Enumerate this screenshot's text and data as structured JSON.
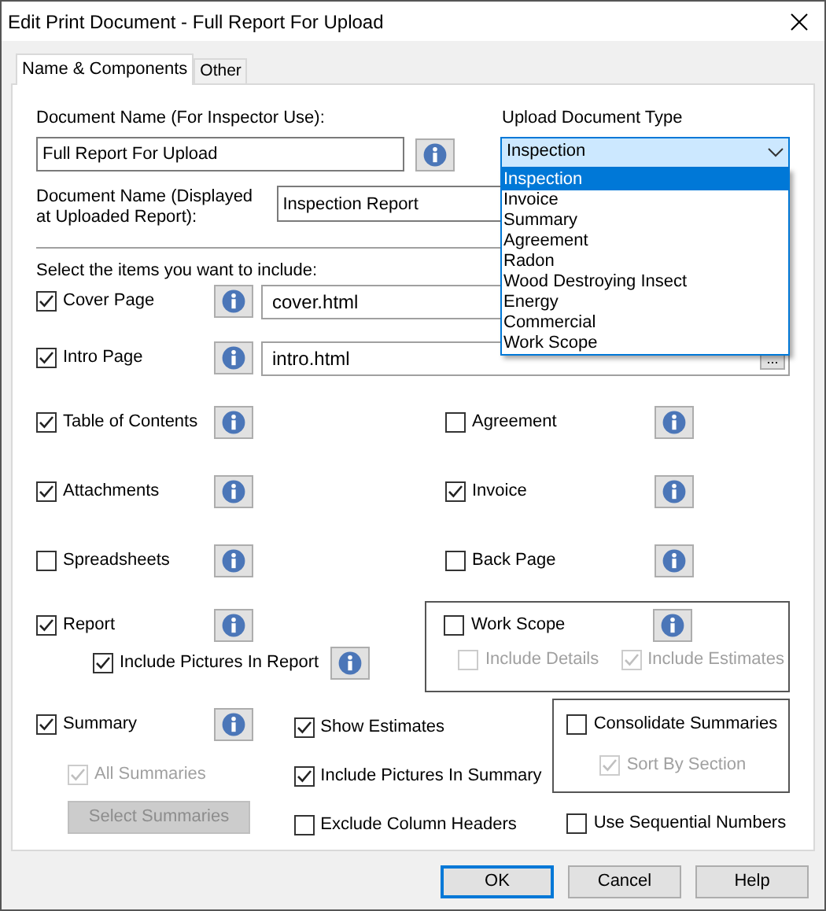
{
  "window": {
    "title": "Edit Print Document - Full Report For Upload"
  },
  "tabs": [
    {
      "label": "Name & Components",
      "selected": true
    },
    {
      "label": "Other",
      "selected": false
    }
  ],
  "document_name": {
    "label": "Document Name (For Inspector Use):",
    "value": "Full Report For Upload"
  },
  "upload_type": {
    "label": "Upload Document Type",
    "value": "Inspection",
    "expanded": true,
    "options": [
      {
        "label": "Inspection",
        "selected": true
      },
      {
        "label": "Invoice",
        "selected": false
      },
      {
        "label": "Summary",
        "selected": false
      },
      {
        "label": "Agreement",
        "selected": false
      },
      {
        "label": "Radon",
        "selected": false
      },
      {
        "label": "Wood Destroying Insect",
        "selected": false
      },
      {
        "label": "Energy",
        "selected": false
      },
      {
        "label": "Commercial",
        "selected": false
      },
      {
        "label": "Work Scope",
        "selected": false
      }
    ]
  },
  "display_name": {
    "label": "Document Name (Displayed at Uploaded Report):",
    "value": "Inspection Report"
  },
  "items_prompt": "Select the items you want to include:",
  "files": [
    {
      "label": "Cover Page",
      "checked": true,
      "value": "cover.html"
    },
    {
      "label": "Intro Page",
      "checked": true,
      "value": "intro.html",
      "browse": "..."
    }
  ],
  "item_rows": [
    {
      "left": {
        "label": "Table of Contents",
        "checked": true
      },
      "right": {
        "label": "Agreement",
        "checked": false
      }
    },
    {
      "left": {
        "label": "Attachments",
        "checked": true
      },
      "right": {
        "label": "Invoice",
        "checked": true
      }
    },
    {
      "left": {
        "label": "Spreadsheets",
        "checked": false
      },
      "right": {
        "label": "Back Page",
        "checked": false
      }
    }
  ],
  "report": {
    "label": "Report",
    "checked": true,
    "pictures": {
      "label": "Include Pictures In Report",
      "checked": true
    }
  },
  "work_scope": {
    "label": "Work Scope",
    "checked": false,
    "options": [
      {
        "label": "Include Details",
        "checked": false,
        "disabled": true
      },
      {
        "label": "Include Estimates",
        "checked": true,
        "disabled": true
      }
    ]
  },
  "summary": {
    "label": "Summary",
    "checked": true,
    "all": {
      "label": "All Summaries",
      "checked": true,
      "disabled": true
    },
    "select_button": {
      "label": "Select Summaries",
      "disabled": true
    }
  },
  "summary_options": [
    {
      "label": "Show Estimates",
      "checked": true
    },
    {
      "label": "Include Pictures In Summary",
      "checked": true
    },
    {
      "label": "Exclude Column Headers",
      "checked": false
    }
  ],
  "consolidate": {
    "label": "Consolidate Summaries",
    "checked": false,
    "sort": {
      "label": "Sort By Section",
      "checked": true,
      "disabled": true
    }
  },
  "sequential": {
    "label": "Use Sequential Numbers",
    "checked": false
  },
  "buttons": [
    {
      "label": "OK",
      "default": true
    },
    {
      "label": "Cancel",
      "default": false
    },
    {
      "label": "Help",
      "default": false
    }
  ]
}
